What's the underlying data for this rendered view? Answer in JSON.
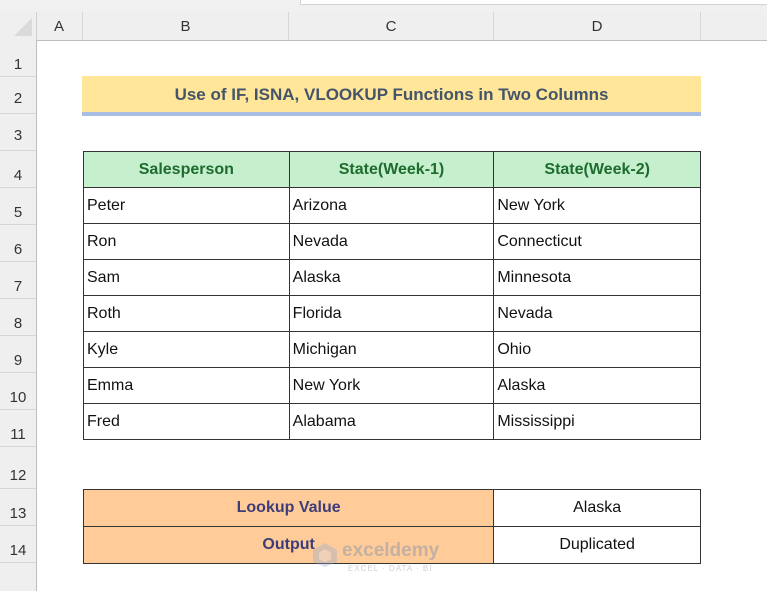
{
  "spreadsheet": {
    "column_headers": [
      "A",
      "B",
      "C",
      "D"
    ],
    "row_headers": [
      "1",
      "2",
      "3",
      "4",
      "5",
      "6",
      "7",
      "8",
      "9",
      "10",
      "11",
      "12",
      "13",
      "14"
    ]
  },
  "title": "Use of IF, ISNA, VLOOKUP Functions in Two Columns",
  "table": {
    "headers": [
      "Salesperson",
      "State(Week-1)",
      "State(Week-2)"
    ],
    "rows": [
      [
        "Peter",
        "Arizona",
        "New York"
      ],
      [
        "Ron",
        "Nevada",
        "Connecticut"
      ],
      [
        "Sam",
        "Alaska",
        "Minnesota"
      ],
      [
        "Roth",
        "Florida",
        "Nevada"
      ],
      [
        "Kyle",
        "Michigan",
        "Ohio"
      ],
      [
        "Emma",
        "New York",
        "Alaska"
      ],
      [
        "Fred",
        "Alabama",
        "Mississippi"
      ]
    ]
  },
  "lookup": {
    "lookup_label": "Lookup Value",
    "lookup_value": "Alaska",
    "output_label": "Output",
    "output_value": "Duplicated"
  },
  "watermark": {
    "brand": "exceldemy",
    "tagline": "EXCEL · DATA · BI"
  },
  "colors": {
    "title_bg": "#ffe699",
    "title_underline": "#a9bce3",
    "header_bg": "#c6efce",
    "header_text": "#1e6b2e",
    "lookup_label_bg": "#ffcc99"
  }
}
